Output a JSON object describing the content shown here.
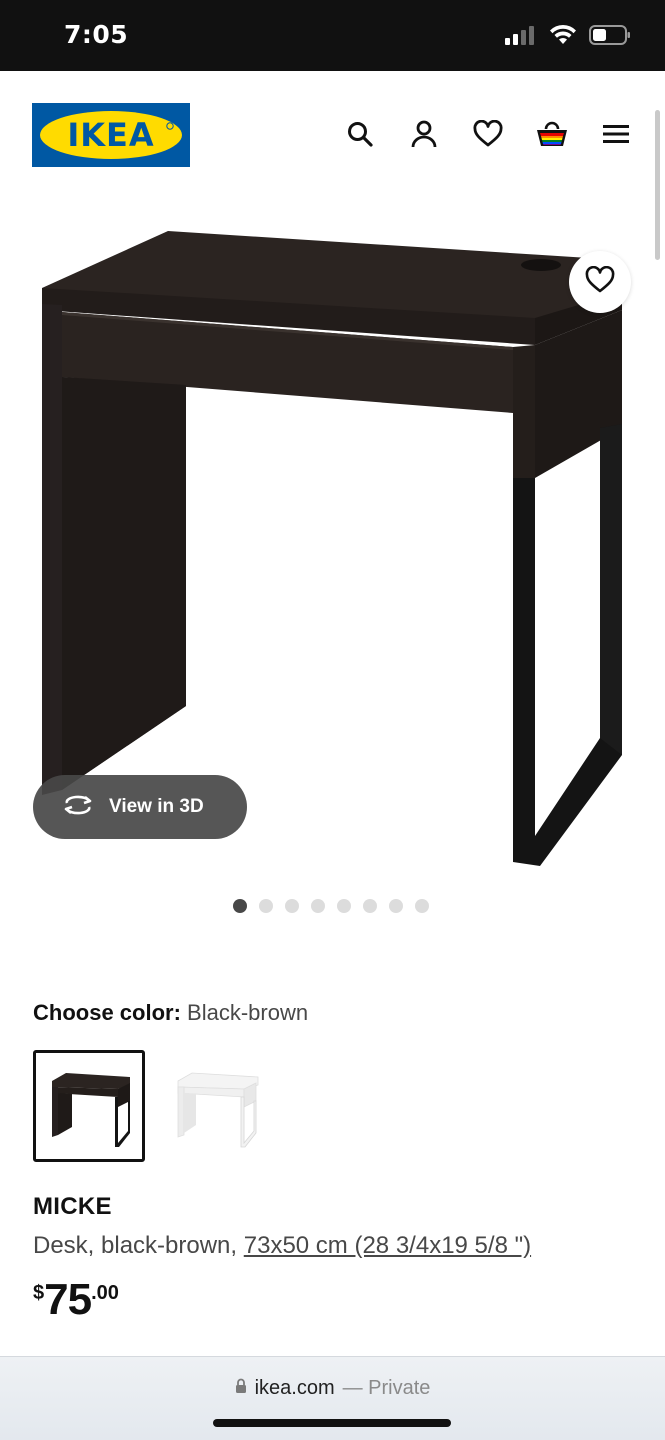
{
  "status": {
    "time": "7:05"
  },
  "header": {
    "logo_text": "IKEA",
    "brand_colors": {
      "blue": "#0058a3",
      "yellow": "#ffdb00"
    },
    "icons": [
      "search-icon",
      "account-icon",
      "heart-icon",
      "shopping-bag-icon",
      "menu-icon"
    ]
  },
  "gallery": {
    "view_3d_label": "View in 3D",
    "dot_count": 8,
    "active_dot": 1
  },
  "color": {
    "label": "Choose color:",
    "value": "Black-brown",
    "options": [
      "Black-brown",
      "White"
    ],
    "selected": "Black-brown"
  },
  "product": {
    "name": "MICKE",
    "type": "Desk, black-brown,",
    "dimensions": "73x50 cm (28 3/4x19 5/8 \")",
    "price_currency": "$",
    "price_integer": "75",
    "price_decimal": ".00"
  },
  "browser": {
    "domain": "ikea.com",
    "mode": "— Private"
  }
}
